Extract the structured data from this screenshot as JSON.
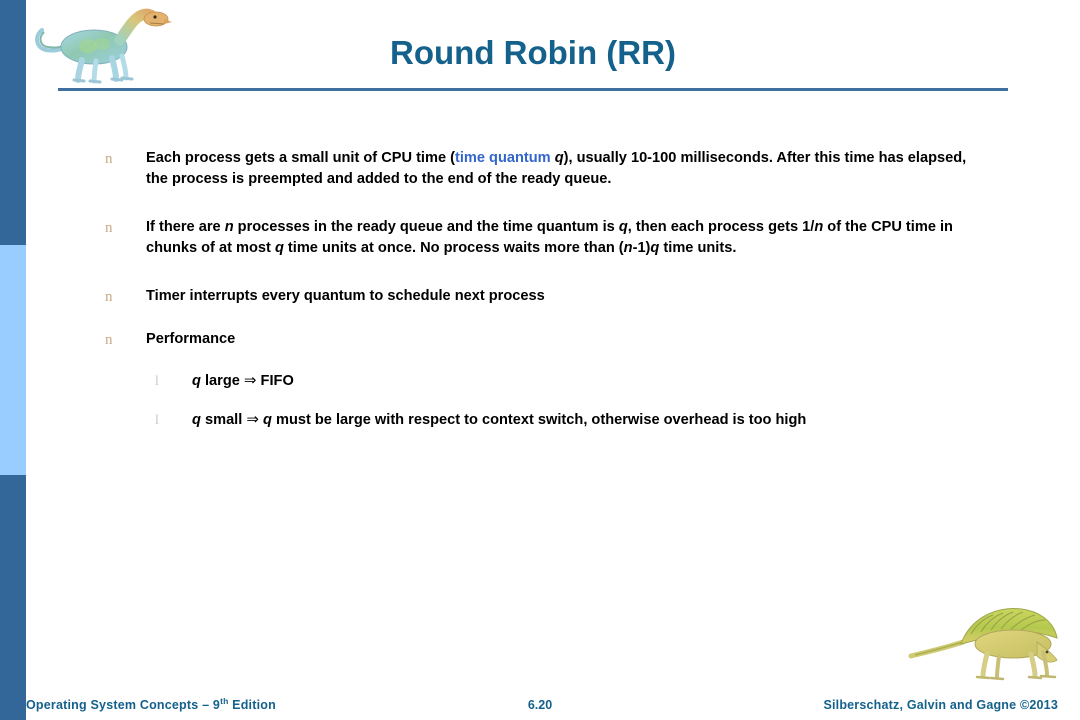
{
  "slide": {
    "title": "Round Robin (RR)",
    "page_number": "6.20",
    "accent_color": "#14618C",
    "rule_color": "#3E6F9E",
    "sidebar_dark": "#336699",
    "sidebar_light": "#99CCFF",
    "highlight_color": "#3366CC",
    "bullet_marker_color": "#C9A986",
    "subbullet_marker_color": "#C8C8C8"
  },
  "bullets": [
    {
      "level": 1,
      "marker": "n",
      "segments": [
        {
          "text": "Each process gets a small unit of CPU time (",
          "style": "plain"
        },
        {
          "text": "time quantum",
          "style": "highlight"
        },
        {
          "text": " ",
          "style": "plain"
        },
        {
          "text": "q",
          "style": "italic"
        },
        {
          "text": "), usually 10-100 milliseconds.  After this time has elapsed, the process is preempted and added to the end of the ready queue.",
          "style": "plain"
        }
      ]
    },
    {
      "level": 1,
      "marker": "n",
      "segments": [
        {
          "text": "If there are ",
          "style": "plain"
        },
        {
          "text": "n",
          "style": "italic"
        },
        {
          "text": " processes in the ready queue and the time quantum is ",
          "style": "plain"
        },
        {
          "text": "q",
          "style": "italic"
        },
        {
          "text": ", then each process gets 1/",
          "style": "plain"
        },
        {
          "text": "n",
          "style": "italic"
        },
        {
          "text": " of the CPU time in chunks of at most ",
          "style": "plain"
        },
        {
          "text": "q",
          "style": "italic"
        },
        {
          "text": " time units at once.  No process waits more than (",
          "style": "plain"
        },
        {
          "text": "n",
          "style": "italic"
        },
        {
          "text": "-1)",
          "style": "plain"
        },
        {
          "text": "q",
          "style": "italic"
        },
        {
          "text": " time units.",
          "style": "plain"
        }
      ]
    },
    {
      "level": 1,
      "marker": "n",
      "segments": [
        {
          "text": "Timer interrupts every quantum to schedule next process",
          "style": "plain"
        }
      ]
    },
    {
      "level": 1,
      "marker": "n",
      "segments": [
        {
          "text": "Performance",
          "style": "plain"
        }
      ]
    },
    {
      "level": 2,
      "marker": "l",
      "segments": [
        {
          "text": "q",
          "style": "italic"
        },
        {
          "text": " large ",
          "style": "plain"
        },
        {
          "text": "⇒",
          "style": "arrow"
        },
        {
          "text": " FIFO",
          "style": "plain"
        }
      ]
    },
    {
      "level": 2,
      "marker": "l",
      "segments": [
        {
          "text": "q",
          "style": "italic"
        },
        {
          "text": " small ",
          "style": "plain"
        },
        {
          "text": "⇒",
          "style": "arrow"
        },
        {
          "text": " ",
          "style": "plain"
        },
        {
          "text": "q",
          "style": "italic"
        },
        {
          "text": " must be large with respect to context switch, otherwise overhead is too high",
          "style": "plain"
        }
      ]
    }
  ],
  "footer": {
    "left_text_before": "Operating System Concepts – 9",
    "left_superscript": "th",
    "left_text_after": " Edition",
    "center_text": "6.20",
    "right_text": "Silberschatz, Galvin and Gagne ©2013"
  },
  "images": {
    "header_dino": "hadrosaur-illustration",
    "footer_dino": "dimetrodon-illustration"
  }
}
